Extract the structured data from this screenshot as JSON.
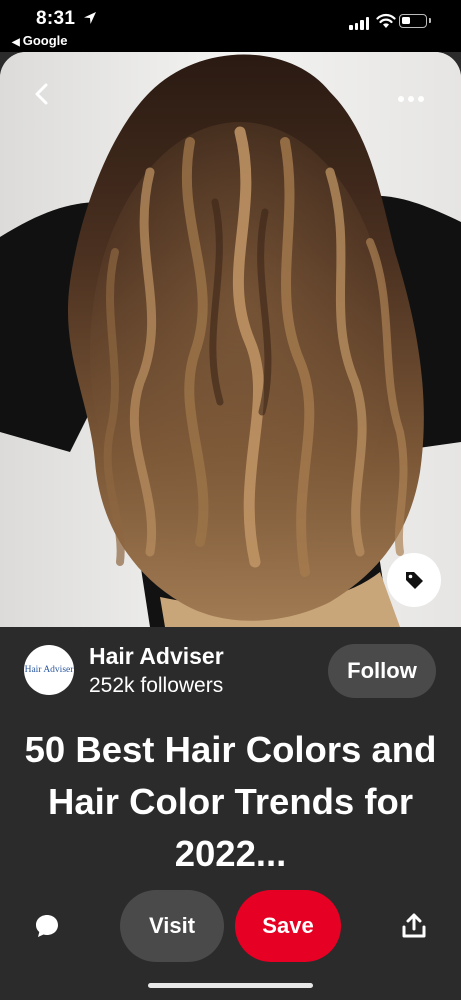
{
  "status_bar": {
    "time": "8:31",
    "back_app": "Google"
  },
  "pin": {
    "image_icon": "photo-of-wavy-balayage-hair",
    "tag_icon": "tag-icon"
  },
  "profile": {
    "avatar_text": "Hair Adviser",
    "name": "Hair Adviser",
    "followers": "252k followers",
    "follow_label": "Follow"
  },
  "title": "50 Best Hair Colors and Hair Color Trends for 2022...",
  "actions": {
    "visit_label": "Visit",
    "save_label": "Save"
  },
  "colors": {
    "background": "#2b2b2b",
    "save": "#e60023",
    "secondary_button": "#4a4a4a"
  }
}
